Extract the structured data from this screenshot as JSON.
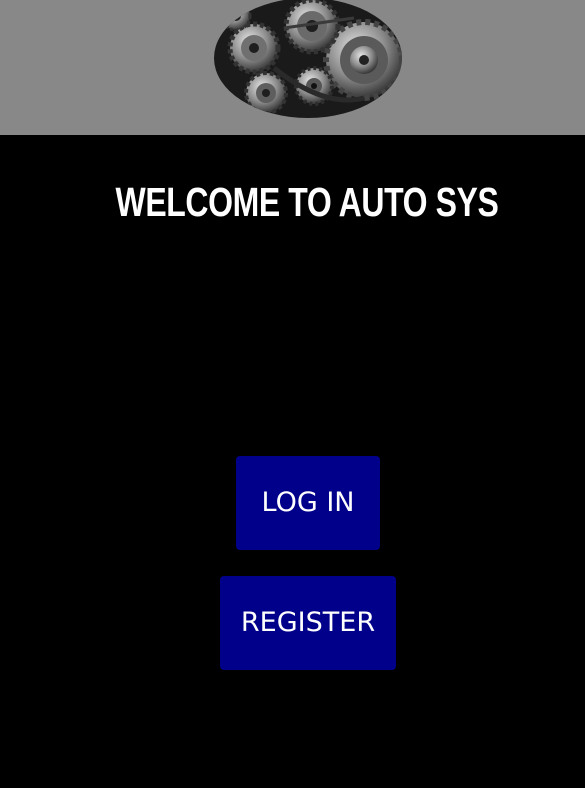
{
  "header": {
    "logo_icon": "gears-engine-icon",
    "background": "#888888"
  },
  "main": {
    "title": "WELCOME TO AUTO SYS",
    "background": "#000000"
  },
  "actions": {
    "login_label": "LOG IN",
    "register_label": "REGISTER",
    "button_color": "#00008b"
  }
}
